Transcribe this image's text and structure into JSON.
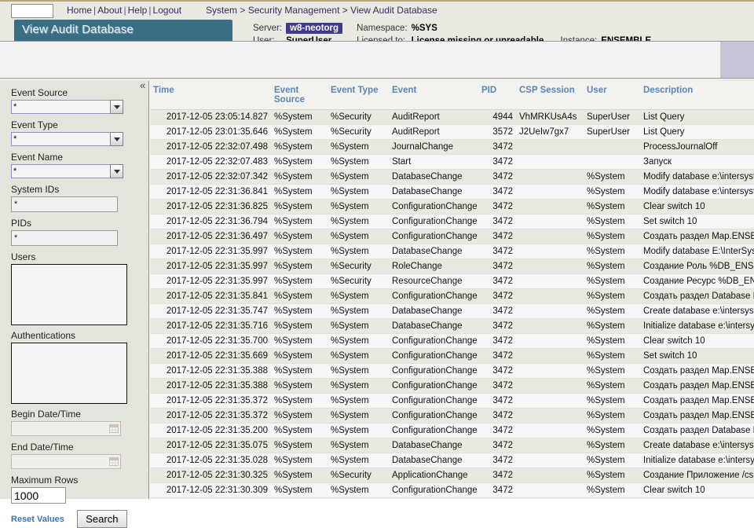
{
  "topnav": {
    "links": [
      "Home",
      "About",
      "Help",
      "Logout"
    ],
    "separator": "|",
    "breadcrumb": [
      "System",
      "Security Management",
      "View Audit Database"
    ],
    "breadcrumb_separator": ">"
  },
  "page_title": "View Audit Database",
  "server_info": {
    "server_label": "Server:",
    "server_value": "w8-neotorg",
    "namespace_label": "Namespace:",
    "namespace_value": "%SYS",
    "user_label": "User:",
    "user_value": "SuperUser",
    "licensed_label": "Licensed to:",
    "licensed_value": "License missing or unreadable.",
    "instance_label": "Instance:",
    "instance_value": "ENSEMBLE"
  },
  "sidebar": {
    "collapse_icon": "«",
    "fields": [
      {
        "label": "Event Source",
        "value": "*",
        "type": "combo"
      },
      {
        "label": "Event Type",
        "value": "*",
        "type": "combo"
      },
      {
        "label": "Event Name",
        "value": "*",
        "type": "combo"
      },
      {
        "label": "System IDs",
        "value": "*",
        "type": "text"
      },
      {
        "label": "PIDs",
        "value": "*",
        "type": "text"
      },
      {
        "label": "Users",
        "value": "",
        "type": "listbox"
      },
      {
        "label": "Authentications",
        "value": "",
        "type": "listbox"
      },
      {
        "label": "Begin Date/Time",
        "value": "",
        "type": "date"
      },
      {
        "label": "End Date/Time",
        "value": "",
        "type": "date"
      },
      {
        "label": "Maximum Rows",
        "value": "1000",
        "type": "number"
      }
    ],
    "reset_label": "Reset Values",
    "search_label": "Search"
  },
  "table": {
    "columns": [
      "Time",
      "Event Source",
      "Event Type",
      "Event",
      "PID",
      "CSP Session",
      "User",
      "Description"
    ],
    "rows": [
      [
        "2017-12-05 23:05:14.827",
        "%System",
        "%Security",
        "AuditReport",
        "4944",
        "VhMRKUsA4s",
        "SuperUser",
        "List Query"
      ],
      [
        "2017-12-05 23:01:35.646",
        "%System",
        "%Security",
        "AuditReport",
        "3572",
        "J2UeIw7gx7",
        "SuperUser",
        "List Query"
      ],
      [
        "2017-12-05 22:32:07.498",
        "%System",
        "%System",
        "JournalChange",
        "3472",
        "",
        "",
        "ProcessJournalOff"
      ],
      [
        "2017-12-05 22:32:07.483",
        "%System",
        "%System",
        "Start",
        "3472",
        "",
        "",
        "Запуск"
      ],
      [
        "2017-12-05 22:32:07.342",
        "%System",
        "%System",
        "DatabaseChange",
        "3472",
        "",
        "%System",
        "Modify database e:\\intersystems\\ensemble"
      ],
      [
        "2017-12-05 22:31:36.841",
        "%System",
        "%System",
        "DatabaseChange",
        "3472",
        "",
        "%System",
        "Modify database e:\\intersystems\\ensemble"
      ],
      [
        "2017-12-05 22:31:36.825",
        "%System",
        "%System",
        "ConfigurationChange",
        "3472",
        "",
        "%System",
        "Clear switch 10"
      ],
      [
        "2017-12-05 22:31:36.794",
        "%System",
        "%System",
        "ConfigurationChange",
        "3472",
        "",
        "%System",
        "Set switch 10"
      ],
      [
        "2017-12-05 22:31:36.497",
        "%System",
        "%System",
        "ConfigurationChange",
        "3472",
        "",
        "%System",
        "Создать раздел Map.ENSEMBLE Global"
      ],
      [
        "2017-12-05 22:31:35.997",
        "%System",
        "%System",
        "DatabaseChange",
        "3472",
        "",
        "%System",
        "Modify database E:\\InterSystems\\Ensembl"
      ],
      [
        "2017-12-05 22:31:35.997",
        "%System",
        "%Security",
        "RoleChange",
        "3472",
        "",
        "%System",
        "Создание Роль %DB_ENSEMBLESECON"
      ],
      [
        "2017-12-05 22:31:35.997",
        "%System",
        "%Security",
        "ResourceChange",
        "3472",
        "",
        "%System",
        "Создание Ресурс %DB_ENSEMBLESECС"
      ],
      [
        "2017-12-05 22:31:35.841",
        "%System",
        "%System",
        "ConfigurationChange",
        "3472",
        "",
        "%System",
        "Создать раздел Database ENSEMBLESE"
      ],
      [
        "2017-12-05 22:31:35.747",
        "%System",
        "%System",
        "DatabaseChange",
        "3472",
        "",
        "%System",
        "Create database e:\\intersystems\\ensemble"
      ],
      [
        "2017-12-05 22:31:35.716",
        "%System",
        "%System",
        "DatabaseChange",
        "3472",
        "",
        "%System",
        "Initialize database e:\\intersystems\\ensemb"
      ],
      [
        "2017-12-05 22:31:35.700",
        "%System",
        "%System",
        "ConfigurationChange",
        "3472",
        "",
        "%System",
        "Clear switch 10"
      ],
      [
        "2017-12-05 22:31:35.669",
        "%System",
        "%System",
        "ConfigurationChange",
        "3472",
        "",
        "%System",
        "Set switch 10"
      ],
      [
        "2017-12-05 22:31:35.388",
        "%System",
        "%System",
        "ConfigurationChange",
        "3472",
        "",
        "%System",
        "Создать раздел Map.ENSEMBLE Global"
      ],
      [
        "2017-12-05 22:31:35.388",
        "%System",
        "%System",
        "ConfigurationChange",
        "3472",
        "",
        "%System",
        "Создать раздел Map.ENSEMBLE Global"
      ],
      [
        "2017-12-05 22:31:35.372",
        "%System",
        "%System",
        "ConfigurationChange",
        "3472",
        "",
        "%System",
        "Создать раздел Map.ENSEMBLE Global"
      ],
      [
        "2017-12-05 22:31:35.372",
        "%System",
        "%System",
        "ConfigurationChange",
        "3472",
        "",
        "%System",
        "Создать раздел Map.ENSEMBLE Global"
      ],
      [
        "2017-12-05 22:31:35.200",
        "%System",
        "%System",
        "ConfigurationChange",
        "3472",
        "",
        "%System",
        "Создать раздел Database ENSEMBLEEN"
      ],
      [
        "2017-12-05 22:31:35.075",
        "%System",
        "%System",
        "DatabaseChange",
        "3472",
        "",
        "%System",
        "Create database e:\\intersystems\\ensemble"
      ],
      [
        "2017-12-05 22:31:35.028",
        "%System",
        "%System",
        "DatabaseChange",
        "3472",
        "",
        "%System",
        "Initialize database e:\\intersystems\\ensemb"
      ],
      [
        "2017-12-05 22:31:30.325",
        "%System",
        "%Security",
        "ApplicationChange",
        "3472",
        "",
        "%System",
        "Создание Приложение /csp/ensemble"
      ],
      [
        "2017-12-05 22:31:30.309",
        "%System",
        "%System",
        "ConfigurationChange",
        "3472",
        "",
        "%System",
        "Clear switch 10"
      ]
    ]
  },
  "colors": {
    "title_tab": "#396e85",
    "header_text": "#5b86b5",
    "chip_bg": "#3b3b8f",
    "link": "#2f2f63",
    "reset_link": "#3a74b8",
    "row_odd": "#e9e9e1",
    "row_even": "#f6f6f4",
    "sidebar_bg": "#e4e4dc",
    "topbar_bg": "#e9e9e2",
    "accent_band": "#c8c6d6"
  }
}
